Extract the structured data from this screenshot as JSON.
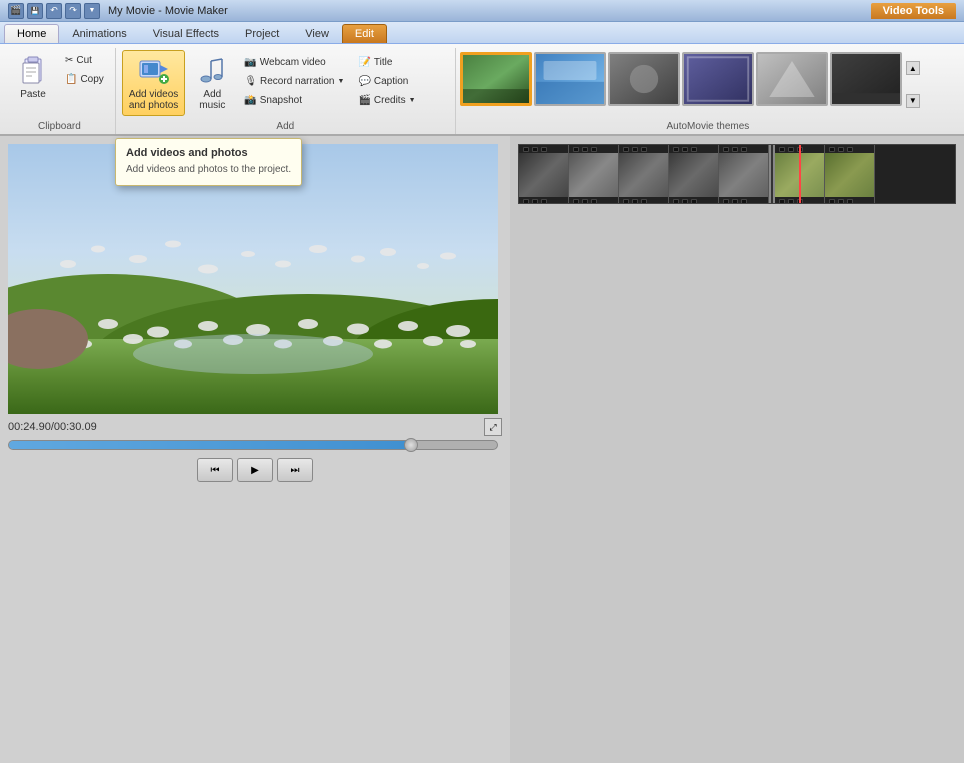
{
  "titleBar": {
    "title": "My Movie - Movie Maker",
    "videoToolsBadge": "Video Tools"
  },
  "tabs": [
    {
      "id": "home",
      "label": "Home",
      "active": true
    },
    {
      "id": "animations",
      "label": "Animations",
      "active": false
    },
    {
      "id": "visualEffects",
      "label": "Visual Effects",
      "active": false
    },
    {
      "id": "project",
      "label": "Project",
      "active": false
    },
    {
      "id": "view",
      "label": "View",
      "active": false
    },
    {
      "id": "edit",
      "label": "Edit",
      "active": false,
      "special": true
    }
  ],
  "ribbon": {
    "clipboard": {
      "label": "Clipboard",
      "paste": "Paste",
      "cut": "Cut",
      "copy": "Copy"
    },
    "add": {
      "label": "Add",
      "addVideos": "Add videos\nand photos",
      "addMusic": "Add\nmusic",
      "webcamVideo": "Webcam video",
      "recordNarration": "Record narration",
      "snapshot": "Snapshot",
      "title": "Title",
      "caption": "Caption",
      "credits": "Credits"
    },
    "autoMovieThemes": {
      "label": "AutoMovie themes"
    }
  },
  "preview": {
    "timeDisplay": "00:24.90/00:30.09",
    "progressPercent": 82
  },
  "playback": {
    "rewindBtn": "⏮",
    "playBtn": "▶",
    "forwardBtn": "⏭"
  },
  "tooltip": {
    "title": "Add videos and photos",
    "description": "Add videos and photos to the project."
  }
}
